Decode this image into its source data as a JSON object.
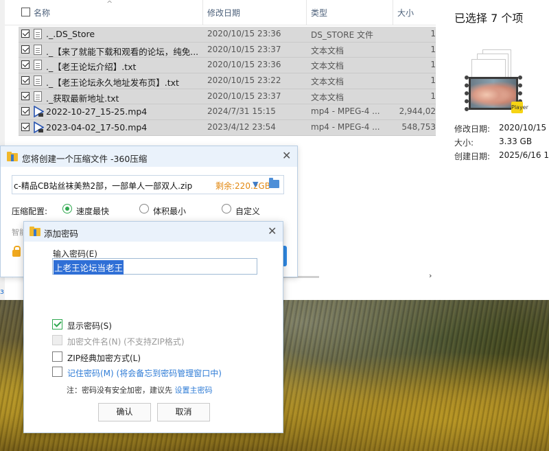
{
  "explorer": {
    "columns": {
      "name": "名称",
      "date": "修改日期",
      "type": "类型",
      "size": "大小"
    },
    "sort_indicator": "^",
    "files": [
      {
        "name": "._.DS_Store",
        "date": "2020/10/15 23:36",
        "type": "DS_STORE 文件",
        "size": "1",
        "icon": "file-icon"
      },
      {
        "name": "._【来了就能下载和观看的论坛，纯免...",
        "date": "2020/10/15 23:37",
        "type": "文本文档",
        "size": "1",
        "icon": "file-icon"
      },
      {
        "name": "._【老王论坛介绍】.txt",
        "date": "2020/10/15 23:36",
        "type": "文本文档",
        "size": "1",
        "icon": "file-icon"
      },
      {
        "name": "._【老王论坛永久地址发布页】.txt",
        "date": "2020/10/15 23:22",
        "type": "文本文档",
        "size": "1",
        "icon": "file-icon"
      },
      {
        "name": "._获取最新地址.txt",
        "date": "2020/10/15 23:37",
        "type": "文本文档",
        "size": "1",
        "icon": "file-icon"
      },
      {
        "name": "2022-10-27_15-25.mp4",
        "date": "2024/7/31 15:15",
        "type": "mp4 - MPEG-4 ...",
        "size": "2,944,02",
        "icon": "video-icon"
      },
      {
        "name": "2023-04-02_17-50.mp4",
        "date": "2023/4/12 23:54",
        "type": "mp4 - MPEG-4 ...",
        "size": "548,753",
        "icon": "video-icon"
      }
    ]
  },
  "details": {
    "selection": "已选择 7 个项",
    "player_badge": "Player",
    "fields": [
      {
        "label": "修改日期:",
        "value": "2020/10/15"
      },
      {
        "label": "大小:",
        "value": "3.33 GB"
      },
      {
        "label": "创建日期:",
        "value": "2025/6/16 1"
      }
    ]
  },
  "compress_dialog": {
    "title": "您将创建一个压缩文件 -360压缩",
    "path": "c-精品CB站丝袜美熟2部，一部单人一部双人.zip",
    "remaining": "剩余:220.2GB",
    "config_label": "压缩配置:",
    "options": [
      "速度最快",
      "体积最小",
      "自定义"
    ],
    "selected_option": "速度最快",
    "hidden_label": "智能"
  },
  "password_dialog": {
    "title": "添加密码",
    "input_label": "输入密码(E)",
    "password_value": "上老王论坛当老王",
    "checkboxes": [
      {
        "label": "显示密码(S)",
        "checked": true,
        "disabled": false
      },
      {
        "label": "加密文件名(N) (不支持ZIP格式)",
        "checked": false,
        "disabled": true
      },
      {
        "label": "ZIP经典加密方式(L)",
        "checked": false,
        "disabled": false
      },
      {
        "label": "记住密码(M) (将会备忘到密码管理窗口中)",
        "checked": false,
        "disabled": false
      }
    ],
    "note_prefix": "注：密码没有安全加密，建议先 ",
    "note_link": "设置主密码",
    "ok_label": "确认",
    "cancel_label": "取消"
  },
  "colors": {
    "selection_row": "#d9d9d9",
    "title_bar": "#eaf2fb",
    "accent_green": "#2fa84f",
    "accent_blue": "#2f7cd6",
    "remaining_orange": "#e2870f"
  }
}
